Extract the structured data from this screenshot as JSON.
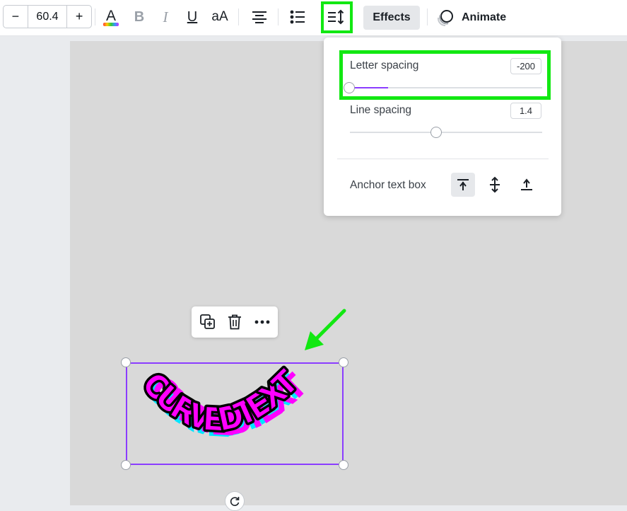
{
  "toolbar": {
    "font_size": "60.4",
    "decrease_label": "−",
    "increase_label": "+",
    "bold_label": "B",
    "italic_label": "I",
    "underline_label": "U",
    "case_label": "aA",
    "effects_label": "Effects",
    "animate_label": "Animate"
  },
  "spacing_panel": {
    "letter_spacing_label": "Letter spacing",
    "letter_spacing_value": "-200",
    "letter_spacing_fraction": 0.0,
    "line_spacing_label": "Line spacing",
    "line_spacing_value": "1.4",
    "line_spacing_fraction": 0.45,
    "anchor_label": "Anchor text box",
    "anchor_options": [
      "top",
      "middle",
      "bottom"
    ],
    "anchor_selected": "top"
  },
  "canvas": {
    "curved_text": "CURVEDTEXT"
  },
  "colors": {
    "accent": "#8b3dff",
    "highlight": "#12e812",
    "text_fill": "#000000",
    "text_shadow_magenta": "#ff00ff",
    "text_shadow_cyan": "#00e5ff"
  }
}
